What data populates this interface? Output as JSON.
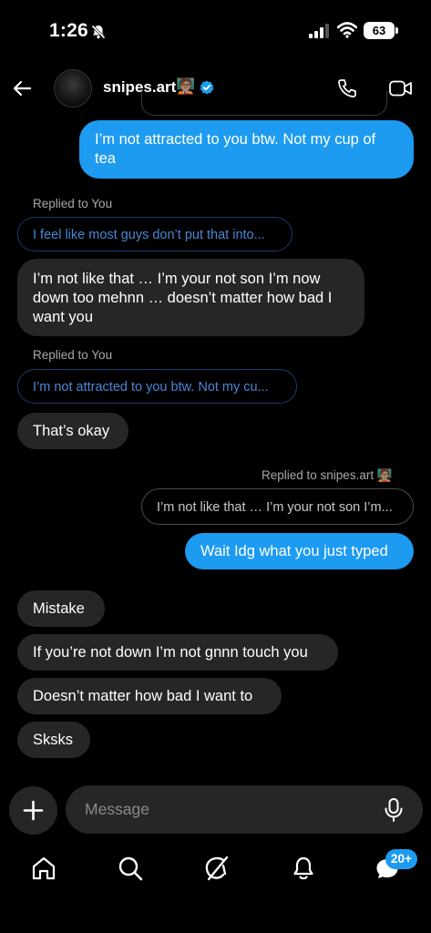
{
  "status_bar": {
    "time": "1:26",
    "battery": "63"
  },
  "header": {
    "username": "snipes.art",
    "badge_emoji": "🧑🏽‍🏫"
  },
  "messages": {
    "m1": {
      "line1": "I’m not attracted to you btw. Not my cup of",
      "line2": "tea"
    },
    "r1_label": "Replied to You",
    "r1_quote": "I feel like most guys don’t put that into...",
    "m2": {
      "line1": "I’m not like that … I’m your not son I’m now",
      "line2": "down too mehnn … doesn’t matter how bad I",
      "line3": "want you"
    },
    "r2_label": "Replied to You",
    "r2_quote": "I’m not attracted to you btw. Not my cu...",
    "m3": "That’s okay",
    "r3_label": "Replied to snipes.art",
    "r3_emoji": "🧑🏽‍🏫",
    "r3_quote": "I’m not like that … I’m your not son I’m...",
    "m4": "Wait Idg what you just typed",
    "m5": "Mistake",
    "m6": "If you’re not down I’m not gnnn touch you",
    "m7": "Doesn’t matter how bad I want to",
    "m8": "Sksks"
  },
  "composer": {
    "placeholder": "Message"
  },
  "nav": {
    "badge": "20+"
  },
  "colors": {
    "accent": "#1d9bf0",
    "incoming_bubble": "#262626",
    "background": "#000000"
  }
}
